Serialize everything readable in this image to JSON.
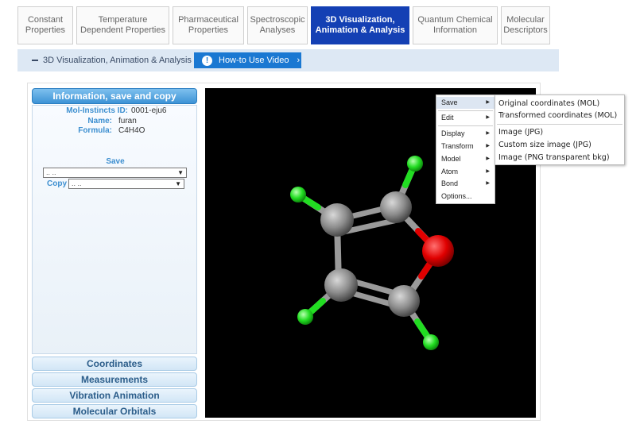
{
  "tabs": [
    {
      "line1": "Constant",
      "line2": "Properties"
    },
    {
      "line1": "Temperature",
      "line2": "Dependent Properties"
    },
    {
      "line1": "Pharmaceutical",
      "line2": "Properties"
    },
    {
      "line1": "Spectroscopic",
      "line2": "Analyses"
    },
    {
      "line1": "3D Visualization,",
      "line2": "Animation & Analysis"
    },
    {
      "line1": "Quantum Chemical",
      "line2": "Information"
    },
    {
      "line1": "Molecular",
      "line2": "Descriptors"
    }
  ],
  "breadcrumb": "3D Visualization, Animation & Analysis",
  "howto_button": "How-to Use Video",
  "info_panel": {
    "title": "Information, save and copy",
    "id_label": "Mol-Instincts ID:",
    "id_value": "0001-eju6",
    "name_label": "Name:",
    "name_value": "furan",
    "formula_label": "Formula:",
    "formula_value": "C4H4O",
    "save_label": "Save",
    "save_select": ".. ..",
    "copy_label": "Copy",
    "copy_select": ".. .."
  },
  "accordion": [
    "Coordinates",
    "Measurements",
    "Vibration Animation",
    "Molecular Orbitals"
  ],
  "menu": {
    "items": [
      "Save",
      "Edit",
      "Display",
      "Transform",
      "Model",
      "Atom",
      "Bond",
      "Options..."
    ],
    "submenu": [
      "Original coordinates (MOL)",
      "Transformed coordinates (MOL)",
      "Image (JPG)",
      "Custom size image (JPG)",
      "Image (PNG transparent bkg)"
    ]
  },
  "colors": {
    "accent": "#1440b4",
    "carbon": "#8c8c8c",
    "oxygen": "#e00000",
    "hydrogen": "#22dd22"
  }
}
